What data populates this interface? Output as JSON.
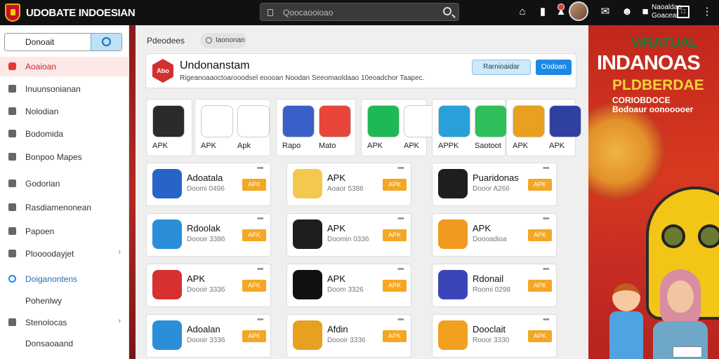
{
  "header": {
    "brand": "UDOBATE INDOESIAN",
    "search_placeholder": "Qoocaooioao",
    "user_name_line1": "Naoaldao",
    "user_name_line2": "Goacear",
    "icons": [
      "home-icon",
      "phone-icon",
      "notification-icon",
      "avatar",
      "chat-icon",
      "game-icon",
      "cart-icon",
      "settings-icon"
    ]
  },
  "sidebar": {
    "search_value": "Donoait",
    "items": [
      {
        "label": "Aoaioan",
        "icon": "home-icon",
        "state": "active"
      },
      {
        "label": "Inuunsonianan",
        "icon": "shield-icon"
      },
      {
        "label": "Nolodian",
        "icon": "book-icon"
      },
      {
        "label": "Bodomida",
        "icon": "grid-icon"
      },
      {
        "label": "Bonpoo Mapes",
        "icon": "map-icon"
      },
      {
        "label": "Godorian",
        "icon": "home-icon"
      },
      {
        "label": "Rasdiamenonean",
        "icon": "gear-icon"
      },
      {
        "label": "Papoen",
        "icon": "user-icon"
      },
      {
        "label": "Ploooodayjet",
        "icon": "folder-icon",
        "chevron": true
      },
      {
        "label": "Doiganontens",
        "icon": "circle-icon",
        "state": "blue"
      },
      {
        "label": "Pohenlwy"
      },
      {
        "label": "Stenolocas",
        "icon": "tag-icon",
        "chevron": true
      },
      {
        "label": "Donsaoaand"
      }
    ]
  },
  "main": {
    "breadcrumb": "Pdeodees",
    "chip": "Iaononan",
    "hero": {
      "logo_text": "Abo",
      "title": "Undonanstam",
      "description": "Rigeanoaaoctoarooodsel eoooan Noodan Seeomaoldaao 10eoadchor Taapec.",
      "secondary_button": "Rarnioaidar",
      "primary_button": "Oodoan"
    },
    "featured_groups": [
      {
        "apps": [
          {
            "label": "APK",
            "color": "#2b2b2b"
          },
          {
            "label": "APK",
            "color": "#ffffff"
          },
          {
            "label": "Apk",
            "color": "#ffffff"
          }
        ]
      },
      {
        "apps": [
          {
            "label": "Rapo",
            "color": "#3a5fc8"
          },
          {
            "label": "Mato",
            "color": "#e8463a"
          }
        ]
      },
      {
        "apps": [
          {
            "label": "APK",
            "color": "#1db954"
          },
          {
            "label": "APK",
            "color": "#ffffff"
          }
        ]
      },
      {
        "apps": [
          {
            "label": "APPK",
            "color": "#2aa0d8"
          },
          {
            "label": "Saotoot",
            "color": "#2fbf5a"
          }
        ]
      },
      {
        "apps": [
          {
            "label": "APK",
            "color": "#e8a020"
          },
          {
            "label": "APK",
            "color": "#3040a0"
          }
        ]
      }
    ],
    "cards": [
      {
        "name": "Adoatala",
        "sub": "Doomi 0496",
        "tag": "APK",
        "color": "#2864c8"
      },
      {
        "name": "APK",
        "sub": "Aoaor 5386",
        "tag": "APK",
        "color": "#f2c94c"
      },
      {
        "name": "Puaridonas",
        "sub": "Dooor A266",
        "tag": "APK",
        "color": "#1e1e1e"
      },
      {
        "name": "Rdoolak",
        "sub": "Doooir 3386",
        "tag": "APK",
        "color": "#2a8fd8"
      },
      {
        "name": "APK",
        "sub": "Doomin 0336",
        "tag": "APK",
        "color": "#1e1e1e"
      },
      {
        "name": "APK",
        "sub": "Doooadioa",
        "tag": "APK",
        "color": "#f29a20"
      },
      {
        "name": "APK",
        "sub": "Doooir 3336",
        "tag": "APK",
        "color": "#d63030"
      },
      {
        "name": "APK",
        "sub": "Doom 3326",
        "tag": "APK",
        "color": "#111111"
      },
      {
        "name": "Rdonail",
        "sub": "Roomi 0298",
        "tag": "APK",
        "color": "#3a46b8"
      },
      {
        "name": "Adoalan",
        "sub": "Doooir 3336",
        "tag": "APK",
        "color": "#2a8fd8"
      },
      {
        "name": "Afdin",
        "sub": "Doooir 3336",
        "tag": "APK",
        "color": "#e8a020"
      },
      {
        "name": "Dooclait",
        "sub": "Rooor 3330",
        "tag": "APK",
        "color": "#f2a020"
      }
    ]
  },
  "ad": {
    "line1": "VIRATUAL",
    "line2": "INDANOAS",
    "line3": "PLDBERDAE",
    "line4a": "CORIOBDOCE",
    "line4b": "Bodoaur oonooooer"
  }
}
